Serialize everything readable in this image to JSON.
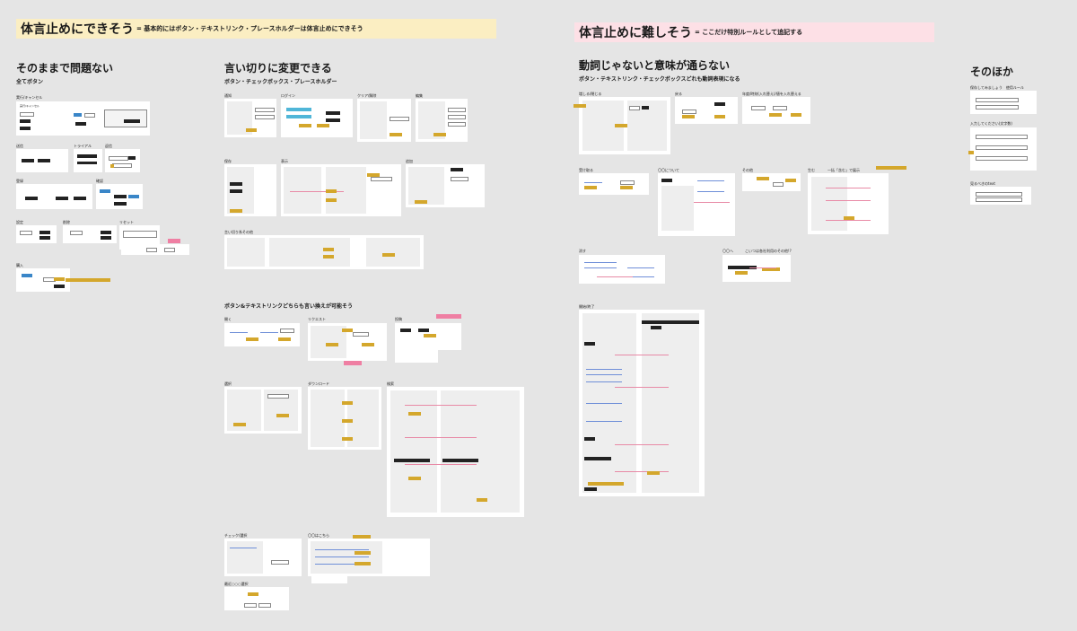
{
  "banners": {
    "left_title": "体言止めにできそう",
    "left_sub": "= 基本的にはボタン・テキストリンク・プレースホルダーは体言止めにできそう",
    "right_title": "体言止めに難しそう",
    "right_sub": "= ここだけ特別ルールとして追記する"
  },
  "sections": {
    "ok": {
      "title": "そのままで問題ない",
      "sub": "全てボタン"
    },
    "rephrase": {
      "title": "言い切りに変更できる",
      "sub": "ボタン・チェックボックス・プレースホルダー"
    },
    "hard": {
      "title": "動詞じゃないと意味が通らない",
      "sub": "ボタン・テキストリンク・チェックボックスどれも動詞表現になる"
    },
    "other": {
      "title": "そのほか"
    },
    "both": {
      "title": "ボタン&テキストリンクどちらも言い換えが可能そう"
    }
  },
  "colors": {
    "yellow_banner": "#fbeec2",
    "pink_banner": "#fde0e6",
    "note": "#d4a72c",
    "pink_note": "#ef7fa3"
  },
  "ok_groups": [
    "実行/キャンセル",
    "送信",
    "トライアル",
    "返信",
    "登録",
    "確認",
    "設定",
    "削除",
    "リセット",
    "購入"
  ],
  "rephrase_groups": [
    "通知",
    "ログイン",
    "クリア/解除",
    "編集",
    "保存",
    "表示",
    "追加",
    "言い切り系その他"
  ],
  "both_groups": [
    "開く",
    "リクエスト",
    "投稿",
    "選択",
    "ダウンロード",
    "検索"
  ],
  "check_groups": [
    "チェック/選択",
    "〇〇はこちら",
    "最近○○○選択"
  ],
  "hard_groups": [
    "増しる/閉じる",
    "戻る",
    "年度/時刻(入れ替え)/値を入れ替える",
    "受け取る",
    "〇〇について",
    "その他",
    "生む",
    "一括「含む」で展示",
    "消す",
    "〇〇へ",
    "こいつは各社利用のその他!?",
    "開始/終了"
  ],
  "other_groups": [
    "保存してみましょう　使用ルール",
    "入力してください(文字数)",
    "見るべきのtext"
  ]
}
